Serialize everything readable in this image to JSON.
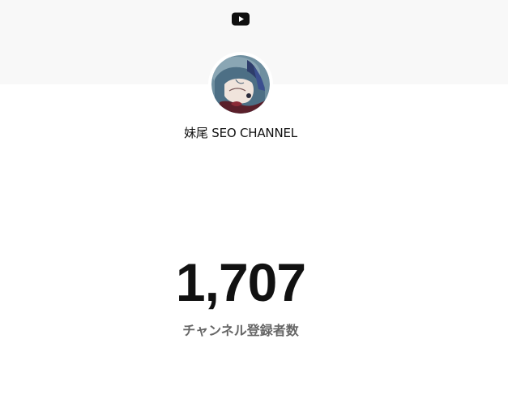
{
  "header": {
    "logo_icon": "youtube-play-icon",
    "logo_color": "#0f0f0f",
    "banner_color": "#f8f8f8"
  },
  "channel": {
    "name": "妹尾 SEO CHANNEL",
    "avatar_icon": "channel-avatar-illustration"
  },
  "stats": {
    "subscriber_count": "1,707",
    "subscriber_label": "チャンネル登録者数"
  }
}
